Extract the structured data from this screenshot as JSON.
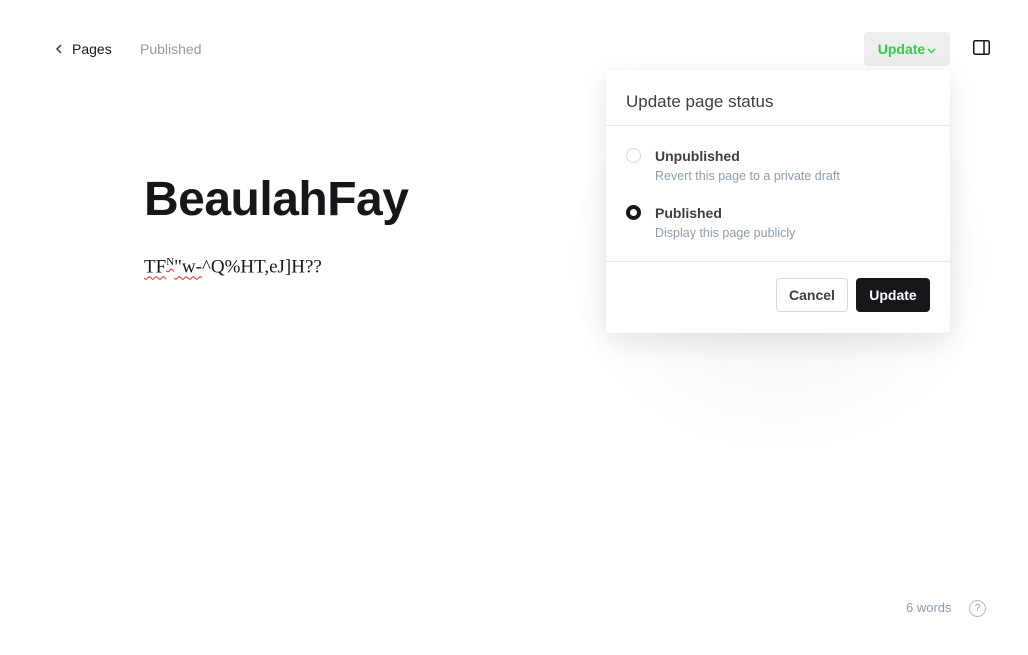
{
  "topbar": {
    "back_label": "Pages",
    "status": "Published",
    "update_label": "Update"
  },
  "editor": {
    "title": "BeaulahFay",
    "body": {
      "seg1": "TF",
      "seg2": "N",
      "seg3": "\"w-",
      "seg4": "^Q%HT,eJ]H??"
    }
  },
  "popup": {
    "title": "Update page status",
    "options": [
      {
        "label": "Unpublished",
        "description": "Revert this page to a private draft",
        "selected": false
      },
      {
        "label": "Published",
        "description": "Display this page publicly",
        "selected": true
      }
    ],
    "cancel_label": "Cancel",
    "confirm_label": "Update"
  },
  "footer": {
    "word_count": "6 words",
    "help_glyph": "?"
  },
  "colors": {
    "accent_green": "#30cf43",
    "dark": "#15171a",
    "muted": "#8e9cac"
  },
  "icons": {
    "back": "chevron-left-icon",
    "dropdown": "chevron-down-icon",
    "sidebar": "sidebar-toggle-icon",
    "help": "help-icon"
  }
}
